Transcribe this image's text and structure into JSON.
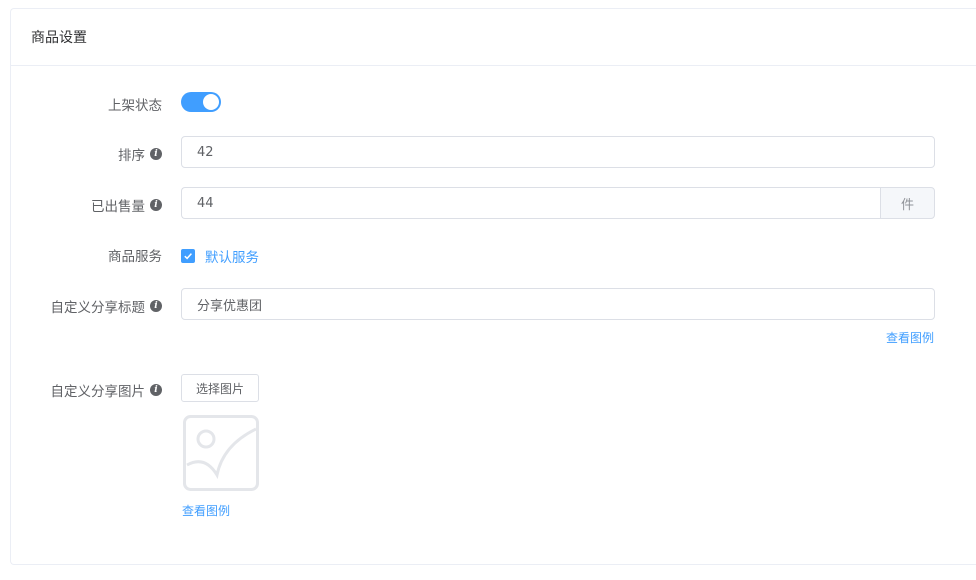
{
  "card": {
    "title": "商品设置"
  },
  "form": {
    "status": {
      "label": "上架状态",
      "enabled": true
    },
    "sort": {
      "label": "排序",
      "value": "42"
    },
    "sold": {
      "label": "已出售量",
      "value": "44",
      "unit": "件"
    },
    "service": {
      "label": "商品服务",
      "option": "默认服务",
      "checked": true
    },
    "share_title": {
      "label": "自定义分享标题",
      "value": "分享优惠团",
      "example_link": "查看图例"
    },
    "share_image": {
      "label": "自定义分享图片",
      "button": "选择图片",
      "example_link": "查看图例"
    }
  },
  "colors": {
    "accent": "#409eff",
    "border": "#dcdfe6",
    "label": "#606266"
  },
  "icons": {
    "info": "info-icon",
    "check": "check-icon",
    "image_placeholder": "image-placeholder-icon"
  }
}
